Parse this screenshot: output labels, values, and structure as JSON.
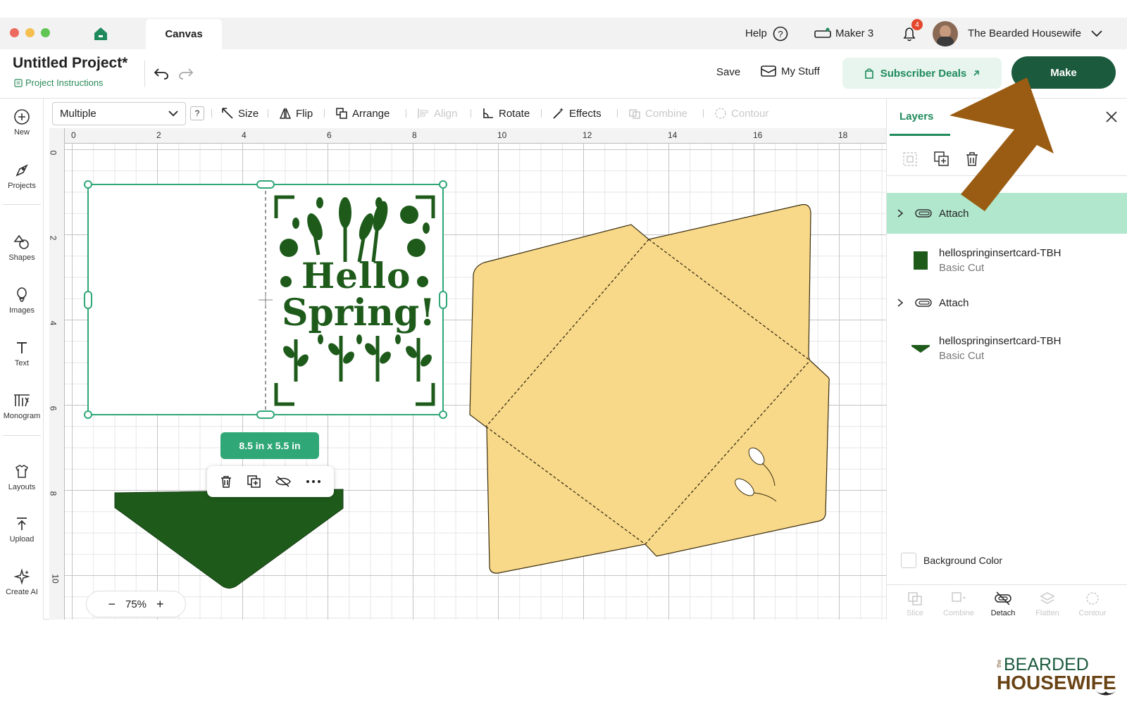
{
  "tabs": {
    "canvas": "Canvas"
  },
  "titlebar": {
    "help": "Help",
    "machine": "Maker 3",
    "notifications_count": "4",
    "user_name": "The Bearded Housewife"
  },
  "project": {
    "title": "Untitled Project*",
    "instructions": "Project Instructions",
    "save": "Save",
    "my_stuff": "My Stuff",
    "subscriber_deals": "Subscriber Deals",
    "make": "Make"
  },
  "sidebar": {
    "items": [
      {
        "label": "New",
        "icon": "plus-circle-icon"
      },
      {
        "label": "Projects",
        "icon": "projects-icon"
      },
      {
        "label": "Shapes",
        "icon": "shapes-icon"
      },
      {
        "label": "Images",
        "icon": "images-icon"
      },
      {
        "label": "Text",
        "icon": "text-icon"
      },
      {
        "label": "Monogram",
        "icon": "monogram-icon"
      },
      {
        "label": "Layouts",
        "icon": "layouts-icon"
      },
      {
        "label": "Upload",
        "icon": "upload-icon"
      },
      {
        "label": "Create AI",
        "icon": "sparkle-icon"
      }
    ]
  },
  "toolbar": {
    "operation": "Multiple",
    "help": "?",
    "size": "Size",
    "flip": "Flip",
    "arrange": "Arrange",
    "align": "Align",
    "rotate": "Rotate",
    "effects": "Effects",
    "combine": "Combine",
    "contour": "Contour"
  },
  "ruler": {
    "h": [
      "0",
      "2",
      "4",
      "6",
      "8",
      "10",
      "12",
      "14",
      "16",
      "18"
    ],
    "v": [
      "0",
      "2",
      "4",
      "6",
      "8",
      "10"
    ]
  },
  "canvas": {
    "card_text_1": "Hello",
    "card_text_2": "Spring!",
    "size_badge": "8.5  in x 5.5  in",
    "zoom": "75%",
    "zoom_minus": "−",
    "zoom_plus": "+"
  },
  "layers": {
    "tab": "Layers",
    "rows": [
      {
        "label": "Attach",
        "type": "group",
        "selected": true
      },
      {
        "label": "hellospringinsertcard-TBH",
        "sub": "Basic Cut"
      },
      {
        "label": "Attach",
        "type": "group",
        "selected": false
      },
      {
        "label": "hellospringinsertcard-TBH",
        "sub": "Basic Cut"
      }
    ],
    "background_color": "Background Color",
    "bottom_tools": [
      "Slice",
      "Combine",
      "Detach",
      "Flatten",
      "Contour"
    ]
  },
  "colors": {
    "brand_green": "#1b5a3d",
    "accent_green": "#2fa777",
    "card_green": "#1e5b1b",
    "envelope": "#f8d98a",
    "arrow": "#9a5c12"
  },
  "watermark": {
    "line1": "BEARDED",
    "line2": "HOUSEWIFE",
    "prefix": "the"
  }
}
